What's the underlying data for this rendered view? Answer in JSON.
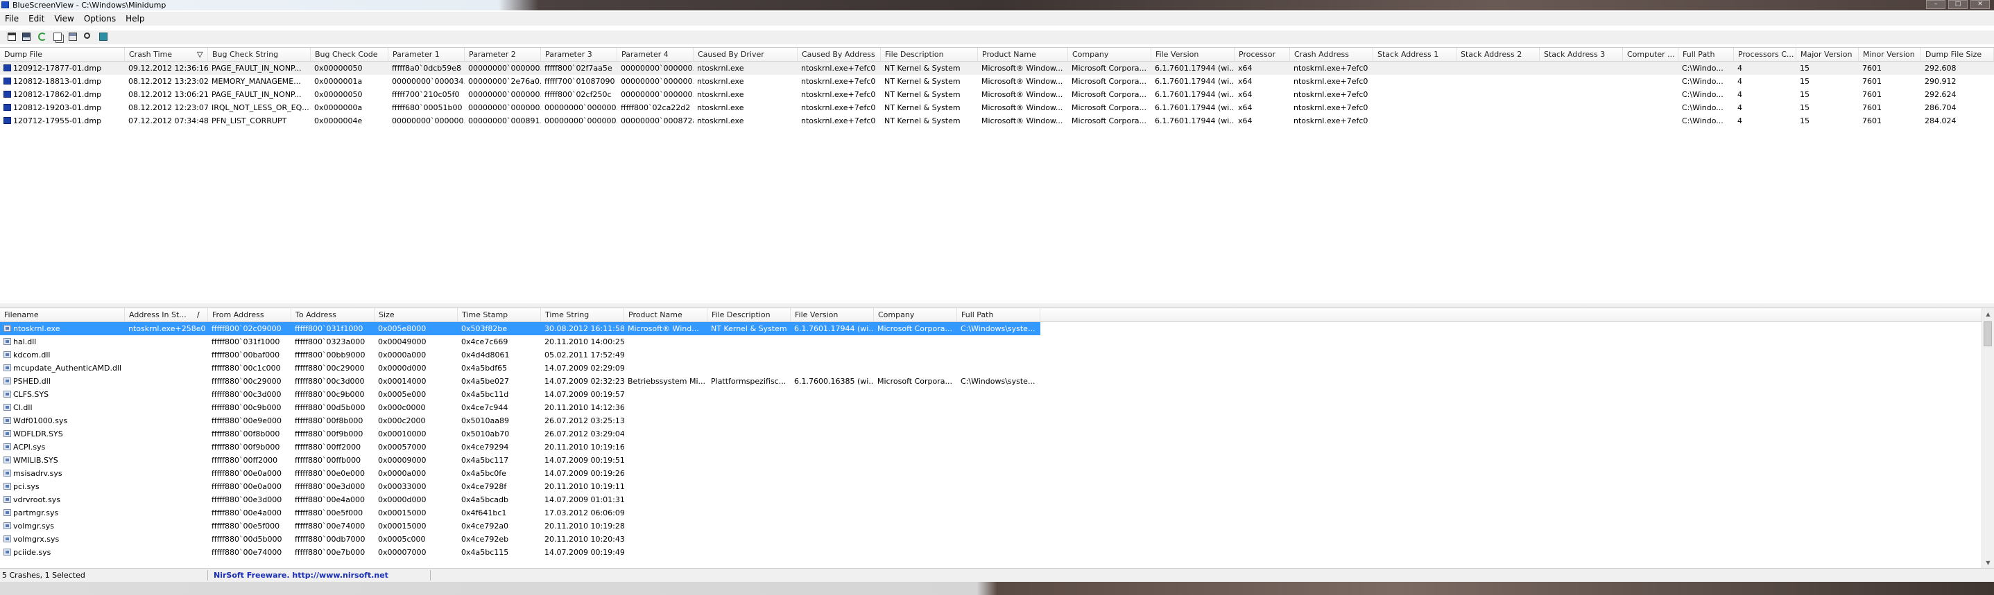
{
  "window": {
    "title": "BlueScreenView  -  C:\\Windows\\Minidump",
    "controls": [
      "–",
      "□",
      "✕"
    ]
  },
  "menu": [
    "File",
    "Edit",
    "View",
    "Options",
    "Help"
  ],
  "toolbar": {
    "buttons": [
      "properties-icon",
      "save-icon",
      "refresh-icon",
      "copy-icon",
      "html-report-icon",
      "find-icon",
      "exit-icon"
    ]
  },
  "top_list": {
    "columns": [
      {
        "label": "Dump File"
      },
      {
        "label": "Crash Time",
        "sort": "▽"
      },
      {
        "label": "Bug Check String"
      },
      {
        "label": "Bug Check Code"
      },
      {
        "label": "Parameter 1"
      },
      {
        "label": "Parameter 2"
      },
      {
        "label": "Parameter 3"
      },
      {
        "label": "Parameter 4"
      },
      {
        "label": "Caused By Driver"
      },
      {
        "label": "Caused By Address"
      },
      {
        "label": "File Description"
      },
      {
        "label": "Product Name"
      },
      {
        "label": "Company"
      },
      {
        "label": "File Version"
      },
      {
        "label": "Processor"
      },
      {
        "label": "Crash Address"
      },
      {
        "label": "Stack Address 1"
      },
      {
        "label": "Stack Address 2"
      },
      {
        "label": "Stack Address 3"
      },
      {
        "label": "Computer ..."
      },
      {
        "label": "Full Path"
      },
      {
        "label": "Processors C..."
      },
      {
        "label": "Major Version"
      },
      {
        "label": "Minor Version"
      },
      {
        "label": "Dump File Size"
      }
    ],
    "rows": [
      [
        "120912-17877-01.dmp",
        "09.12.2012 12:36:16",
        "PAGE_FAULT_IN_NONP...",
        "0x00000050",
        "fffff8a0`0dcb59e8",
        "00000000`000000...",
        "fffff800`02f7aa5e",
        "00000000`000000...",
        "ntoskrnl.exe",
        "ntoskrnl.exe+7efc0",
        "NT Kernel & System",
        "Microsoft® Window...",
        "Microsoft Corpora...",
        "6.1.7601.17944 (wi...",
        "x64",
        "ntoskrnl.exe+7efc0",
        "",
        "",
        "",
        "",
        "C:\\Windo...",
        "4",
        "15",
        "7601",
        "292.608"
      ],
      [
        "120812-18813-01.dmp",
        "08.12.2012 13:23:02",
        "MEMORY_MANAGEME...",
        "0x0000001a",
        "00000000`000034...",
        "00000000`2e76a0...",
        "fffff700`01087090",
        "00000000`000000...",
        "ntoskrnl.exe",
        "ntoskrnl.exe+7efc0",
        "NT Kernel & System",
        "Microsoft® Window...",
        "Microsoft Corpora...",
        "6.1.7601.17944 (wi...",
        "x64",
        "ntoskrnl.exe+7efc0",
        "",
        "",
        "",
        "",
        "C:\\Windo...",
        "4",
        "15",
        "7601",
        "290.912"
      ],
      [
        "120812-17862-01.dmp",
        "08.12.2012 13:06:21",
        "PAGE_FAULT_IN_NONP...",
        "0x00000050",
        "fffff700`210c05f0",
        "00000000`000000...",
        "fffff800`02cf250c",
        "00000000`000000...",
        "ntoskrnl.exe",
        "ntoskrnl.exe+7efc0",
        "NT Kernel & System",
        "Microsoft® Window...",
        "Microsoft Corpora...",
        "6.1.7601.17944 (wi...",
        "x64",
        "ntoskrnl.exe+7efc0",
        "",
        "",
        "",
        "",
        "C:\\Windo...",
        "4",
        "15",
        "7601",
        "292.624"
      ],
      [
        "120812-19203-01.dmp",
        "08.12.2012 12:23:07",
        "IRQL_NOT_LESS_OR_EQ...",
        "0x0000000a",
        "fffff680`00051b00",
        "00000000`000000...",
        "00000000`000000...",
        "fffff800`02ca22d2",
        "ntoskrnl.exe",
        "ntoskrnl.exe+7efc0",
        "NT Kernel & System",
        "Microsoft® Window...",
        "Microsoft Corpora...",
        "6.1.7601.17944 (wi...",
        "x64",
        "ntoskrnl.exe+7efc0",
        "",
        "",
        "",
        "",
        "C:\\Windo...",
        "4",
        "15",
        "7601",
        "286.704"
      ],
      [
        "120712-17955-01.dmp",
        "07.12.2012 07:34:48",
        "PFN_LIST_CORRUPT",
        "0x0000004e",
        "00000000`000000...",
        "00000000`000891...",
        "00000000`000000...",
        "00000000`000872af",
        "ntoskrnl.exe",
        "ntoskrnl.exe+7efc0",
        "NT Kernel & System",
        "Microsoft® Window...",
        "Microsoft Corpora...",
        "6.1.7601.17944 (wi...",
        "x64",
        "ntoskrnl.exe+7efc0",
        "",
        "",
        "",
        "",
        "C:\\Windo...",
        "4",
        "15",
        "7601",
        "284.024"
      ]
    ]
  },
  "bottom_list": {
    "columns": [
      {
        "label": "Filename"
      },
      {
        "label": "Address In St...",
        "sort": "/"
      },
      {
        "label": "From Address"
      },
      {
        "label": "To Address"
      },
      {
        "label": "Size"
      },
      {
        "label": "Time Stamp"
      },
      {
        "label": "Time String"
      },
      {
        "label": "Product Name"
      },
      {
        "label": "File Description"
      },
      {
        "label": "File Version"
      },
      {
        "label": "Company"
      },
      {
        "label": "Full Path"
      }
    ],
    "rows": [
      [
        "ntoskrnl.exe",
        "ntoskrnl.exe+258e0",
        "fffff800`02c09000",
        "fffff800`031f1000",
        "0x005e8000",
        "0x503f82be",
        "30.08.2012 16:11:58",
        "Microsoft® Wind...",
        "NT Kernel & System",
        "6.1.7601.17944 (wi...",
        "Microsoft Corpora...",
        "C:\\Windows\\syste..."
      ],
      [
        "hal.dll",
        "",
        "fffff800`031f1000",
        "fffff800`0323a000",
        "0x00049000",
        "0x4ce7c669",
        "20.11.2010 14:00:25",
        "",
        "",
        "",
        "",
        ""
      ],
      [
        "kdcom.dll",
        "",
        "fffff800`00baf000",
        "fffff800`00bb9000",
        "0x0000a000",
        "0x4d4d8061",
        "05.02.2011 17:52:49",
        "",
        "",
        "",
        "",
        ""
      ],
      [
        "mcupdate_AuthenticAMD.dll",
        "",
        "fffff880`00c1c000",
        "fffff880`00c29000",
        "0x0000d000",
        "0x4a5bdf65",
        "14.07.2009 02:29:09",
        "",
        "",
        "",
        "",
        ""
      ],
      [
        "PSHED.dll",
        "",
        "fffff880`00c29000",
        "fffff880`00c3d000",
        "0x00014000",
        "0x4a5be027",
        "14.07.2009 02:32:23",
        "Betriebssystem Mi...",
        "Plattformspezifisc...",
        "6.1.7600.16385 (wi...",
        "Microsoft Corpora...",
        "C:\\Windows\\syste..."
      ],
      [
        "CLFS.SYS",
        "",
        "fffff880`00c3d000",
        "fffff880`00c9b000",
        "0x0005e000",
        "0x4a5bc11d",
        "14.07.2009 00:19:57",
        "",
        "",
        "",
        "",
        ""
      ],
      [
        "CI.dll",
        "",
        "fffff880`00c9b000",
        "fffff880`00d5b000",
        "0x000c0000",
        "0x4ce7c944",
        "20.11.2010 14:12:36",
        "",
        "",
        "",
        "",
        ""
      ],
      [
        "Wdf01000.sys",
        "",
        "fffff880`00e9e000",
        "fffff880`00f8b000",
        "0x000c2000",
        "0x5010aa89",
        "26.07.2012 03:25:13",
        "",
        "",
        "",
        "",
        ""
      ],
      [
        "WDFLDR.SYS",
        "",
        "fffff880`00f8b000",
        "fffff880`00f9b000",
        "0x00010000",
        "0x5010ab70",
        "26.07.2012 03:29:04",
        "",
        "",
        "",
        "",
        ""
      ],
      [
        "ACPI.sys",
        "",
        "fffff880`00f9b000",
        "fffff880`00ff2000",
        "0x00057000",
        "0x4ce79294",
        "20.11.2010 10:19:16",
        "",
        "",
        "",
        "",
        ""
      ],
      [
        "WMILIB.SYS",
        "",
        "fffff880`00ff2000",
        "fffff880`00ffb000",
        "0x00009000",
        "0x4a5bc117",
        "14.07.2009 00:19:51",
        "",
        "",
        "",
        "",
        ""
      ],
      [
        "msisadrv.sys",
        "",
        "fffff880`00e0a000",
        "fffff880`00e0e000",
        "0x0000a000",
        "0x4a5bc0fe",
        "14.07.2009 00:19:26",
        "",
        "",
        "",
        "",
        ""
      ],
      [
        "pci.sys",
        "",
        "fffff880`00e0a000",
        "fffff880`00e3d000",
        "0x00033000",
        "0x4ce7928f",
        "20.11.2010 10:19:11",
        "",
        "",
        "",
        "",
        ""
      ],
      [
        "vdrvroot.sys",
        "",
        "fffff880`00e3d000",
        "fffff880`00e4a000",
        "0x0000d000",
        "0x4a5bcadb",
        "14.07.2009 01:01:31",
        "",
        "",
        "",
        "",
        ""
      ],
      [
        "partmgr.sys",
        "",
        "fffff880`00e4a000",
        "fffff880`00e5f000",
        "0x00015000",
        "0x4f641bc1",
        "17.03.2012 06:06:09",
        "",
        "",
        "",
        "",
        ""
      ],
      [
        "volmgr.sys",
        "",
        "fffff880`00e5f000",
        "fffff880`00e74000",
        "0x00015000",
        "0x4ce792a0",
        "20.11.2010 10:19:28",
        "",
        "",
        "",
        "",
        ""
      ],
      [
        "volmgrx.sys",
        "",
        "fffff880`00d5b000",
        "fffff880`00db7000",
        "0x0005c000",
        "0x4ce792eb",
        "20.11.2010 10:20:43",
        "",
        "",
        "",
        "",
        ""
      ],
      [
        "pciide.sys",
        "",
        "fffff880`00e74000",
        "fffff880`00e7b000",
        "0x00007000",
        "0x4a5bc115",
        "14.07.2009 00:19:49",
        "",
        "",
        "",
        "",
        ""
      ]
    ]
  },
  "status": {
    "summary": "5 Crashes, 1 Selected",
    "credit": "NirSoft Freeware.  http://www.nirsoft.net"
  }
}
